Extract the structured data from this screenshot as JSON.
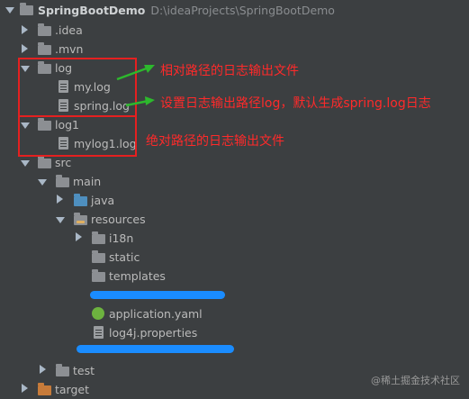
{
  "tree": {
    "project": {
      "name": "SpringBootDemo",
      "path": "D:\\ideaProjects\\SpringBootDemo"
    },
    "items": {
      "idea": ".idea",
      "mvn": ".mvn",
      "log": "log",
      "my_log": "my.log",
      "spring_log": "spring.log",
      "log1": "log1",
      "mylog1": "mylog1.log",
      "src": "src",
      "main": "main",
      "java": "java",
      "resources": "resources",
      "i18n": "i18n",
      "static": "static",
      "templates": "templates",
      "application_yaml": "application.yaml",
      "log4j": "log4j.properties",
      "test": "test",
      "target": "target"
    }
  },
  "annotations": {
    "relative": "相对路径的日志输出文件",
    "default": "设置日志输出路径log，默认生成spring.log日志",
    "absolute": "绝对路径的日志输出文件"
  },
  "watermark": "@稀土掘金技术社区",
  "colors": {
    "background": "#3c3f41",
    "annotation": "#ff2a2a",
    "arrow": "#2db82d",
    "redaction": "#1a8cff"
  }
}
